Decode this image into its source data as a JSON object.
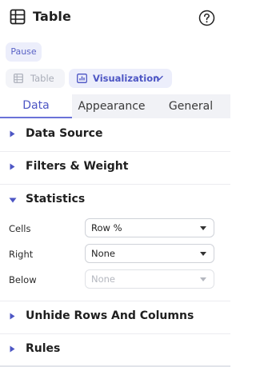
{
  "header": {
    "title": "Table"
  },
  "pause_label": "Pause",
  "view": {
    "table_label": "Table",
    "visualization_label": "Visualization"
  },
  "tabs": [
    {
      "label": "Data",
      "active": true
    },
    {
      "label": "Appearance",
      "active": false
    },
    {
      "label": "General",
      "active": false
    }
  ],
  "sections": {
    "data_source": "Data Source",
    "filters_weight": "Filters & Weight",
    "statistics": "Statistics",
    "unhide": "Unhide Rows And Columns",
    "rules": "Rules"
  },
  "statistics": {
    "cells": {
      "label": "Cells",
      "value": "Row %"
    },
    "right": {
      "label": "Right",
      "value": "None"
    },
    "below": {
      "label": "Below",
      "value": "None",
      "disabled": true
    }
  },
  "colors": {
    "accent": "#4d56c4",
    "caret": "#4d56c4",
    "tab_bg": "#f1f2f6"
  }
}
